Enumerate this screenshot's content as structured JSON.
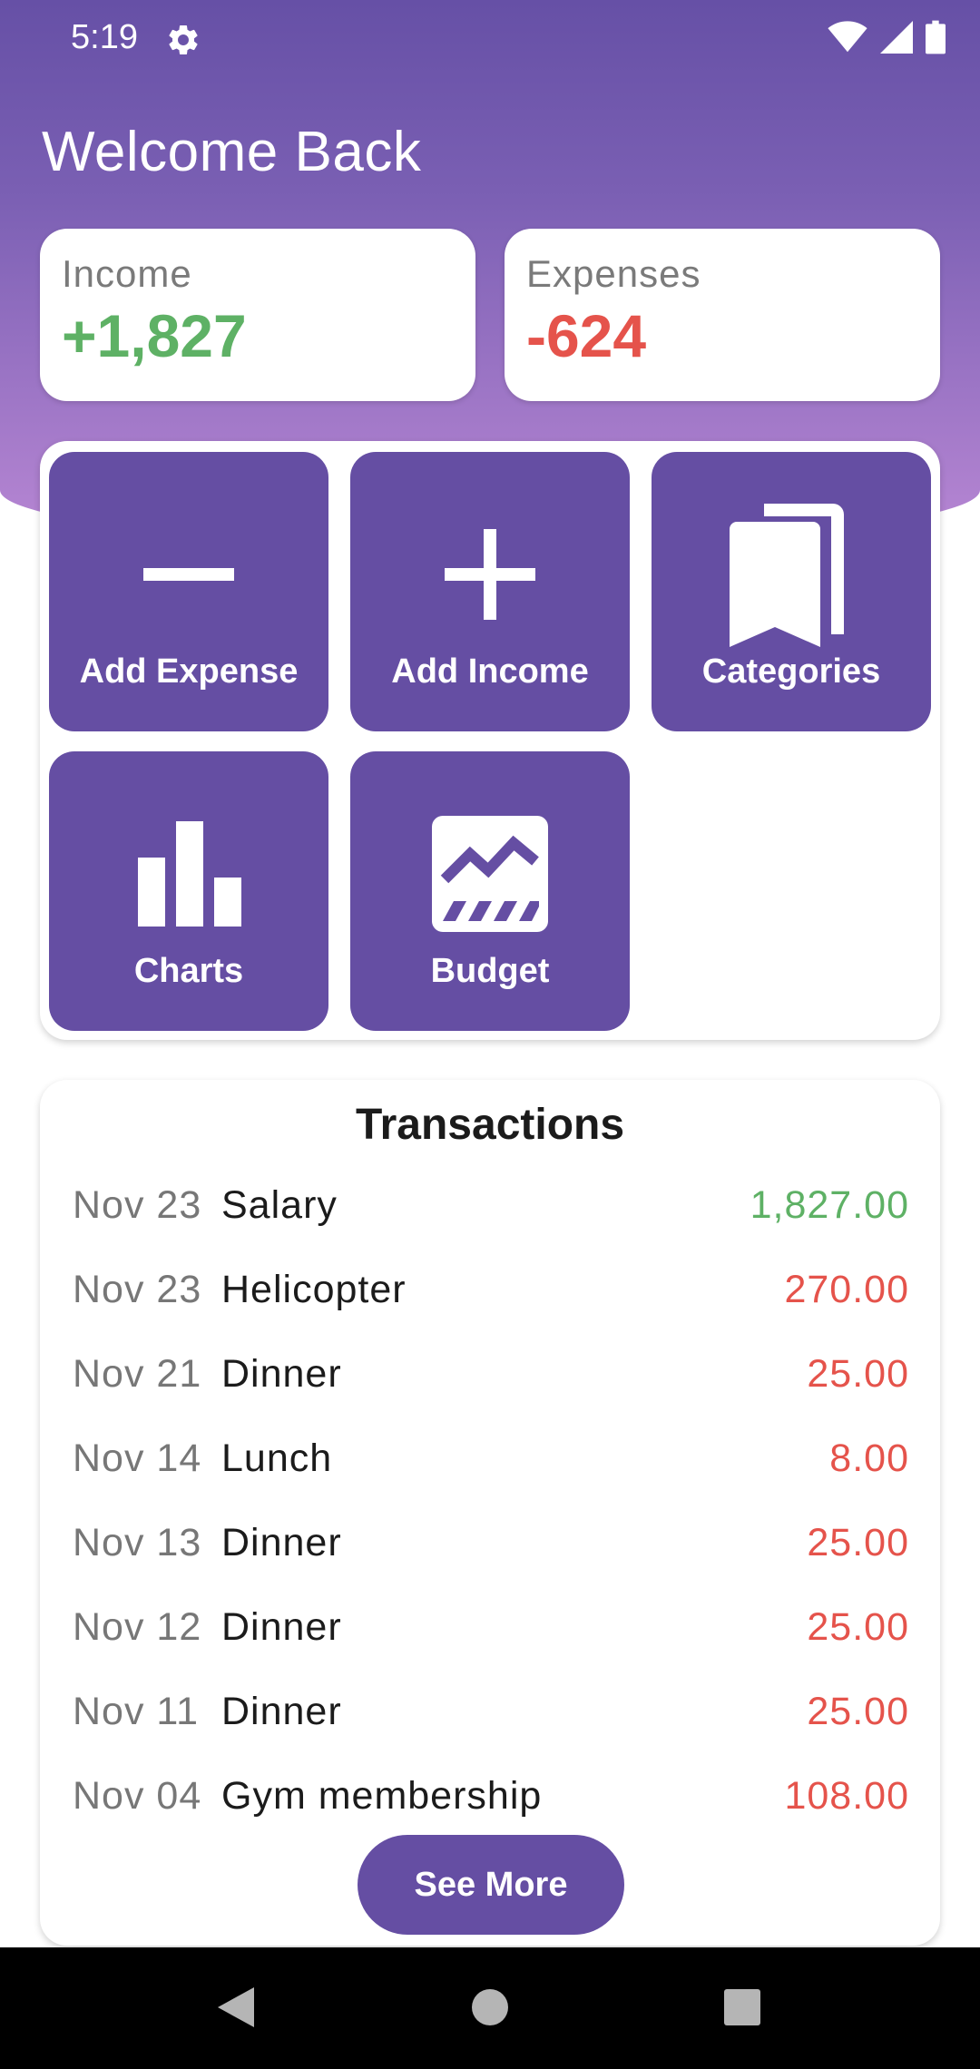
{
  "status_bar": {
    "time": "5:19"
  },
  "header": {
    "title": "Welcome Back"
  },
  "summary": {
    "income": {
      "label": "Income",
      "value": "+1,827"
    },
    "expenses": {
      "label": "Expenses",
      "value": "-624"
    }
  },
  "actions": [
    {
      "label": "Add Expense",
      "icon": "minus-icon"
    },
    {
      "label": "Add Income",
      "icon": "plus-icon"
    },
    {
      "label": "Categories",
      "icon": "bookmarks-icon"
    },
    {
      "label": "Charts",
      "icon": "bar-chart-icon"
    },
    {
      "label": "Budget",
      "icon": "trending-chart-icon"
    }
  ],
  "transactions": {
    "title": "Transactions",
    "rows": [
      {
        "date": "Nov 23",
        "name": "Salary",
        "amount": "1,827.00",
        "type": "income"
      },
      {
        "date": "Nov 23",
        "name": "Helicopter",
        "amount": "270.00",
        "type": "expense"
      },
      {
        "date": "Nov 21",
        "name": "Dinner",
        "amount": "25.00",
        "type": "expense"
      },
      {
        "date": "Nov 14",
        "name": "Lunch",
        "amount": "8.00",
        "type": "expense"
      },
      {
        "date": "Nov 13",
        "name": "Dinner",
        "amount": "25.00",
        "type": "expense"
      },
      {
        "date": "Nov 12",
        "name": "Dinner",
        "amount": "25.00",
        "type": "expense"
      },
      {
        "date": "Nov 11",
        "name": "Dinner",
        "amount": "25.00",
        "type": "expense"
      },
      {
        "date": "Nov 04",
        "name": "Gym membership",
        "amount": "108.00",
        "type": "expense"
      }
    ],
    "see_more_label": "See More"
  },
  "colors": {
    "primary": "#654ea3",
    "income": "#5eb165",
    "expense": "#e5534b"
  }
}
